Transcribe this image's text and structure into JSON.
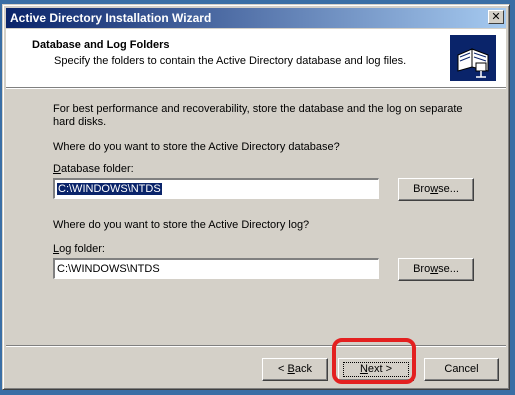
{
  "window": {
    "title": "Active Directory Installation Wizard",
    "close_label": "✕"
  },
  "header": {
    "title": "Database and Log Folders",
    "subtitle": "Specify the folders to contain the Active Directory database and log files.",
    "icon": "book-folders-icon"
  },
  "body": {
    "intro": "For best performance and recoverability, store the database and the log on separate hard disks.",
    "db_question": "Where do you want to store the Active Directory database?",
    "db_label_hotkey": "D",
    "db_label_rest": "atabase folder:",
    "db_value": "C:\\WINDOWS\\NTDS",
    "log_question": "Where do you want to store the Active Directory log?",
    "log_label_hotkey": "L",
    "log_label_rest": "og folder:",
    "log_value": "C:\\WINDOWS\\NTDS",
    "browse_hotkey": "w",
    "browse_pre": "Bro",
    "browse_post": "se..."
  },
  "footer": {
    "back_arrow": "< ",
    "back_hotkey": "B",
    "back_rest": "ack",
    "next_hotkey": "N",
    "next_rest": "ext >",
    "cancel_label": "Cancel"
  },
  "colors": {
    "title_gradient_start": "#0a246a",
    "title_gradient_end": "#a6caf0",
    "highlight": "#e32020",
    "desktop": "#3a6ea5"
  }
}
